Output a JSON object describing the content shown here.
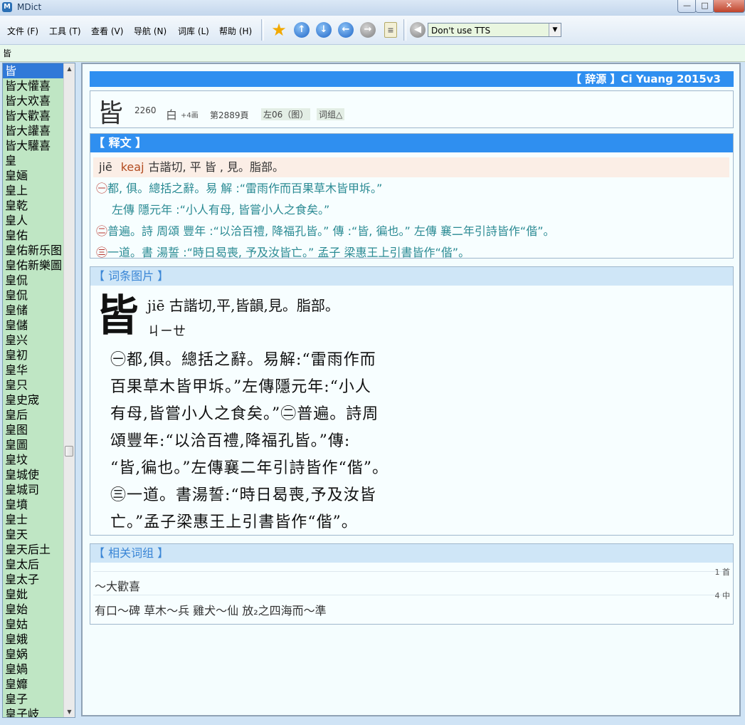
{
  "window": {
    "title": "MDict",
    "app_icon": "mdict-app-icon",
    "minimize": "—",
    "maximize": "□",
    "close": "✕"
  },
  "menu": [
    "文件 (F)",
    "工具 (T)",
    "查看 (V)",
    "导航 (N)",
    "词库 (L)",
    "帮助 (H)"
  ],
  "toolbar": {
    "tts_value": "Don't use TTS",
    "icons": [
      "star-icon",
      "arrow-up-icon",
      "arrow-down-icon",
      "arrow-left-icon",
      "arrow-right-icon",
      "clipboard-icon",
      "speaker-icon"
    ]
  },
  "search": {
    "value": "皆"
  },
  "wordlist": [
    "皆",
    "皆大懽喜",
    "皆大欢喜",
    "皆大歡喜",
    "皆大讙喜",
    "皆大驩喜",
    "皇",
    "皇婳",
    "皇上",
    "皇乾",
    "皇人",
    "皇佑",
    "皇佑新乐图",
    "皇佑新樂圖",
    "皇侃",
    "皇侃",
    "皇储",
    "皇儲",
    "皇兴",
    "皇初",
    "皇华",
    "皇只",
    "皇史宬",
    "皇后",
    "皇图",
    "皇圖",
    "皇坟",
    "皇城使",
    "皇城司",
    "皇墳",
    "皇士",
    "皇天",
    "皇天后土",
    "皇太后",
    "皇太子",
    "皇妣",
    "皇始",
    "皇姑",
    "皇娥",
    "皇娲",
    "皇媧",
    "皇孊",
    "皇子",
    "皇子岐"
  ],
  "dict_title": "【 辞源 】Ci Yuang 2015v3",
  "headword": {
    "char": "皆",
    "number": "2260",
    "radical": "白",
    "strokes": "+4画",
    "page": "第2889頁",
    "tag1": "左06（图）",
    "tag2": "词组△"
  },
  "explanation": {
    "title": "【 释文 】",
    "pinyin": "jiē",
    "keaj": "keaj",
    "fanqie": "古諧切, 平 皆 , 見。脂部。",
    "lines": [
      {
        "mark": "㊀",
        "text": "都, 俱。總括之辭。易 解 :“雷雨作而百果草木皆甲坼。”"
      },
      {
        "mark": "",
        "text": "左傳 隱元年 :“小人有母, 皆嘗小人之食矣。”"
      },
      {
        "mark": "㊁",
        "text": "普遍。詩 周頌 豐年 :“以洽百禮, 降福孔皆。” 傳 :“皆, 徧也。” 左傳 襄二年引詩皆作“偕”。"
      },
      {
        "mark": "㊂",
        "text": "一道。書 湯誓 :“時日曷喪, 予及汝皆亡。” 孟子 梁惠王上引書皆作“偕”。"
      }
    ]
  },
  "image_section": {
    "title": "【 词条图片 】",
    "big": "皆",
    "pinyin_line": "jiē  古諧切,平,皆韻,見。脂部。",
    "bopomofo": "ㄐㄧㄝ",
    "lines": [
      "㊀都,俱。總括之辭。易解:“雷雨作而",
      "百果草木皆甲坼。”左傳隱元年:“小人",
      "有母,皆嘗小人之食矣。”㊁普遍。詩周",
      "頌豐年:“以洽百禮,降福孔皆。”傳:",
      "“皆,徧也。”左傳襄二年引詩皆作“偕”。",
      "㊂一道。書湯誓:“時日曷喪,予及汝皆",
      "亡。”孟子梁惠王上引書皆作“偕”。"
    ]
  },
  "related": {
    "title": "【 相关词组 】",
    "groups": [
      {
        "count": "1 首",
        "items": "～大歡喜"
      },
      {
        "count": "4 中",
        "items": "有口～碑   草木～兵   雞犬～仙   放₂之四海而～準"
      }
    ]
  },
  "colors": {
    "banner": "#2f8ff0",
    "wordlist_bg": "#bfe6c4",
    "selected": "#3079d8",
    "definition_text": "#2a8a93",
    "marker": "#b7332a"
  }
}
